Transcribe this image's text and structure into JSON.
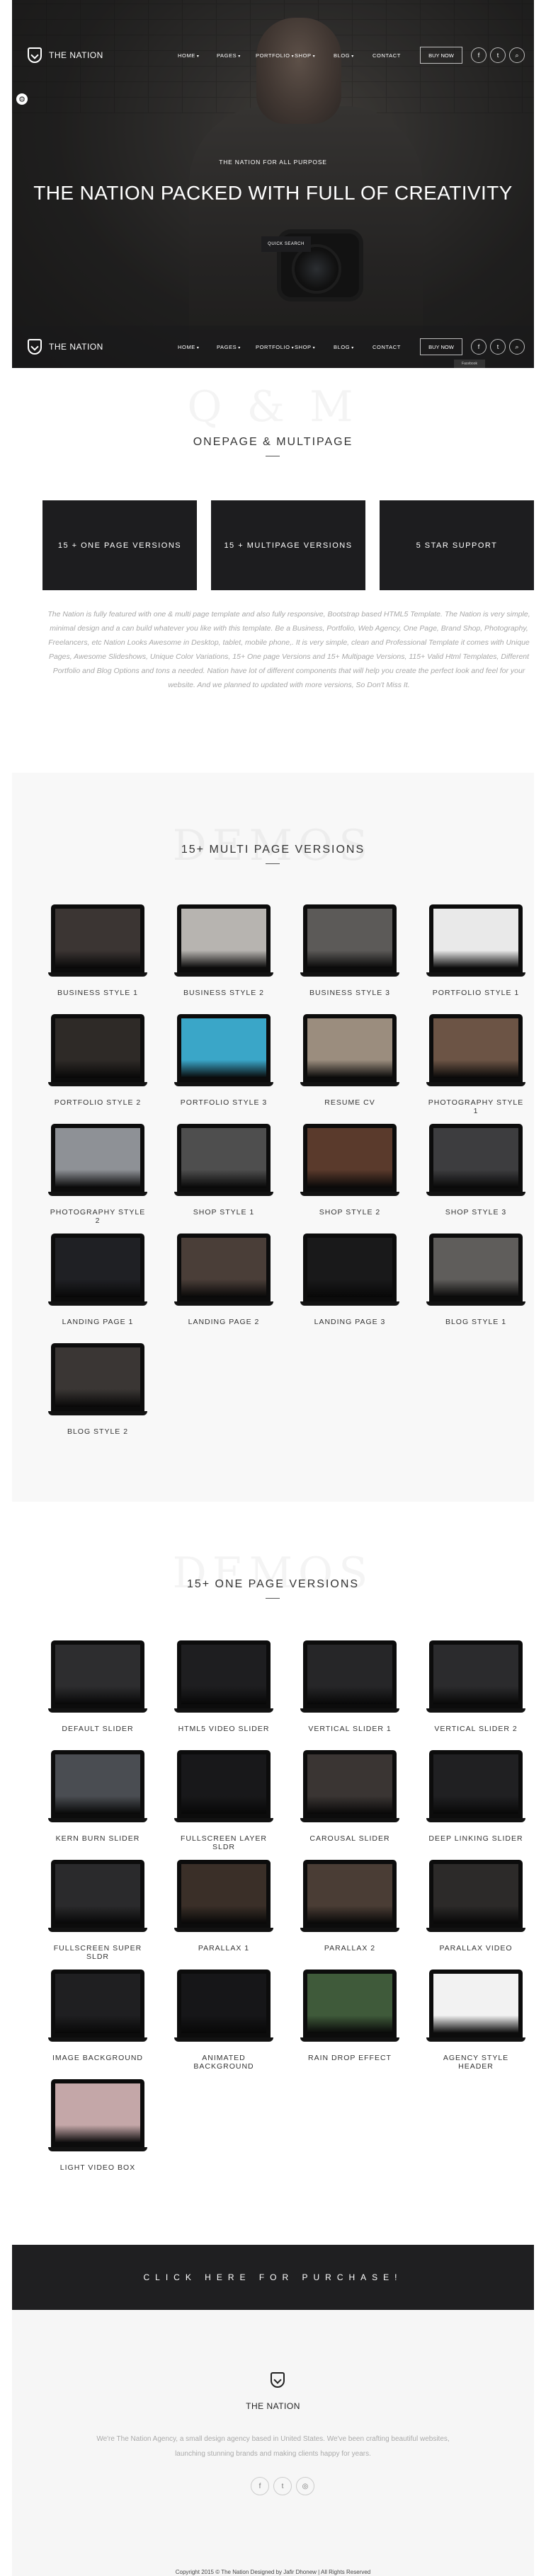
{
  "site": {
    "logo_text": "THE NATION"
  },
  "nav": {
    "items": [
      {
        "label": "HOME",
        "caret": "▾"
      },
      {
        "label": "PAGES",
        "caret": "▾"
      },
      {
        "label": "PORTFOLIO",
        "caret": "▾"
      },
      {
        "label": "SHOP",
        "caret": "▾"
      },
      {
        "label": "BLOG",
        "caret": "▾"
      },
      {
        "label": "CONTACT",
        "caret": ""
      }
    ],
    "buy_label": "BUY NOW",
    "social": [
      "f",
      "t",
      "⌕"
    ]
  },
  "hero": {
    "kicker": "THE NATION FOR ALL PURPOSE",
    "title": "THE NATION PACKED WITH FULL OF CREATIVITY",
    "button": "QUICK SEARCH",
    "tooltip": "Facebook"
  },
  "onepage": {
    "bg_word": "Q & M",
    "title": "ONEPAGE & MULTIPAGE",
    "features": [
      "15 + ONE PAGE VERSIONS",
      "15 + MULTIPAGE VERSIONS",
      "5 STAR SUPPORT"
    ],
    "intro": "The Nation is fully featured with one & multi page template and also fully responsive, Bootstrap based HTML5 Template. The Nation is very simple, minimal design and a can build whatever you like with this template. Be a Business, Portfolio, Web Agency, One Page, Brand Shop, Photography, Freelancers, etc Nation Looks Awesome in Desktop, tablet, mobile phone,. It is very simple, clean and Professional Template it comes with Unique Pages, Awesome Slideshows, Unique Color Variations, 15+ One page Versions and 15+ Multipage Versions, 115+ Valid Html Templates, Different Portfolio and Blog Options and tons a needed. Nation have lot of different components that will help you create the perfect look and feel for your website. And we planned to updated with more versions, So Don't Miss It."
  },
  "multi": {
    "bg_word": "DEMOS",
    "title": "15+ MULTI PAGE VERSIONS",
    "cards": [
      {
        "label": "BUSINESS STYLE 1",
        "screen": "#3b3533"
      },
      {
        "label": "BUSINESS STYLE 2",
        "screen": "#b7b4b0"
      },
      {
        "label": "BUSINESS STYLE 3",
        "screen": "#5c5a58"
      },
      {
        "label": "PORTFOLIO STYLE 1",
        "screen": "#e9e9e9"
      },
      {
        "label": "PORTFOLIO STYLE 2",
        "screen": "#2e2a27"
      },
      {
        "label": "PORTFOLIO STYLE 3",
        "screen": "#3aa6c8"
      },
      {
        "label": "RESUME CV",
        "screen": "#9b8d7e"
      },
      {
        "label": "PHOTOGRAPHY STYLE 1",
        "screen": "#6c5445"
      },
      {
        "label": "PHOTOGRAPHY STYLE 2",
        "screen": "#8e9196"
      },
      {
        "label": "SHOP STYLE 1",
        "screen": "#4e4e4e"
      },
      {
        "label": "SHOP STYLE 2",
        "screen": "#5a3a2c"
      },
      {
        "label": "SHOP STYLE 3",
        "screen": "#3d3d3f"
      },
      {
        "label": "LANDING PAGE 1",
        "screen": "#1f2024"
      },
      {
        "label": "LANDING PAGE 2",
        "screen": "#4a3e38"
      },
      {
        "label": "LANDING PAGE 3",
        "screen": "#19191a"
      },
      {
        "label": "BLOG STYLE 1",
        "screen": "#5f5d5b"
      },
      {
        "label": "BLOG STYLE 2",
        "screen": "#3a3634"
      }
    ]
  },
  "one": {
    "bg_word": "DEMOS",
    "title": "15+ ONE PAGE VERSIONS",
    "cards": [
      {
        "label": "DEFAULT SLIDER",
        "screen": "#2d2d2f"
      },
      {
        "label": "HTML5 VIDEO SLIDER",
        "screen": "#1e1e20"
      },
      {
        "label": "VERTICAL SLIDER 1",
        "screen": "#262628"
      },
      {
        "label": "VERTICAL SLIDER 2",
        "screen": "#2b2b2d"
      },
      {
        "label": "KERN BURN SLIDER",
        "screen": "#4a4d52"
      },
      {
        "label": "FULLSCREEN LAYER SLDR",
        "screen": "#18181a"
      },
      {
        "label": "CAROUSAL SLIDER",
        "screen": "#3a3533"
      },
      {
        "label": "DEEP LINKING SLIDER",
        "screen": "#202022"
      },
      {
        "label": "FULLSCREEN SUPER SLDR",
        "screen": "#2a2a2c"
      },
      {
        "label": "PARALLAX 1",
        "screen": "#3a2f28"
      },
      {
        "label": "PARALLAX 2",
        "screen": "#4a3d35"
      },
      {
        "label": "PARALLAX VIDEO",
        "screen": "#2c2a29"
      },
      {
        "label": "IMAGE BACKGROUND",
        "screen": "#1f1f21"
      },
      {
        "label": "ANIMATED BACKGROUND",
        "screen": "#161618"
      },
      {
        "label": "RAIN DROP EFFECT",
        "screen": "#3f5a3a"
      },
      {
        "label": "AGENCY STYLE HEADER",
        "screen": "#f2f2f2"
      },
      {
        "label": "LIGHT VIDEO BOX",
        "screen": "#c4a7a8"
      }
    ]
  },
  "cta": {
    "label": "CLICK HERE FOR PURCHASE!"
  },
  "footer": {
    "name": "THE NATION",
    "text": "We're The Nation Agency, a small design agency based in United States. We've been crafting beautiful websites, launching stunning brands and making clients happy for years.",
    "social": [
      "f",
      "t",
      "◎"
    ],
    "copyright": "Copyright 2015 © The Nation Designed by Jafir Dhonew | All Rights Reserved"
  }
}
